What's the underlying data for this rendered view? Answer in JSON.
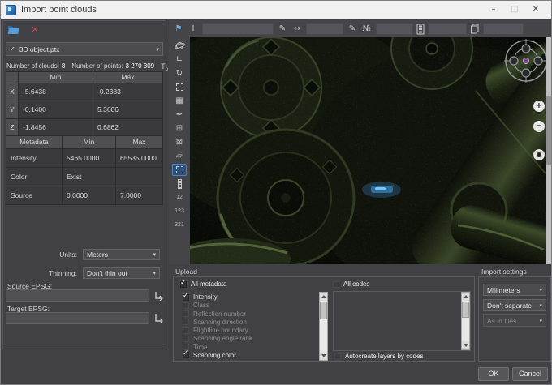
{
  "window": {
    "title": "Import point clouds"
  },
  "titlebar": {
    "minimize_glyph": "–",
    "maximize_glyph": "□",
    "close_glyph": "✕"
  },
  "icons": {
    "chevron_down": "▾",
    "check": "✓",
    "delete": "✕",
    "flag": "⚑",
    "ibeam": "I",
    "pencil": "✎",
    "measure": "↔",
    "numero": "№",
    "axis_corner": "∟",
    "rotate": "↻",
    "grid": "▦",
    "brush": "✒",
    "select_add": "⊞",
    "select_remove": "⊠",
    "polygon": "▱",
    "t_zero": "T",
    "t_zero_sub": "o",
    "plus": "+",
    "minus": "−"
  },
  "left_panel": {
    "file_dropdown": {
      "value": "3D object.ptx"
    },
    "clouds_label": "Number of clouds:",
    "clouds_value": "8",
    "points_label": "Number of points:",
    "points_value": "3 270 309",
    "bounds_table": {
      "headers": [
        "",
        "Min",
        "Max"
      ],
      "rows": [
        {
          "axis": "X",
          "min": "-5.6438",
          "max": "-0.2383"
        },
        {
          "axis": "Y",
          "min": "-0.1400",
          "max": "5.3606"
        },
        {
          "axis": "Z",
          "min": "-1.8456",
          "max": "0.6862"
        }
      ]
    },
    "metadata_table": {
      "headers": [
        "Metadata",
        "Min",
        "Max"
      ],
      "rows": [
        {
          "name": "Intensity",
          "min": "5465.0000",
          "max": "65535.0000"
        },
        {
          "name": "Color",
          "min": "Exist",
          "max": ""
        },
        {
          "name": "Source",
          "min": "0.0000",
          "max": "7.0000"
        }
      ]
    },
    "units_label": "Units:",
    "units_value": "Meters",
    "thinning_label": "Thinning:",
    "thinning_value": "Don't thin out",
    "source_epsg_label": "Source EPSG:",
    "source_epsg_value": "",
    "target_epsg_label": "Target EPSG:",
    "target_epsg_value": ""
  },
  "viewport": {
    "scale_buttons": [
      "12",
      "123",
      "321"
    ]
  },
  "upload": {
    "title": "Upload",
    "all_metadata_label": "All metadata",
    "all_codes_label": "All codes",
    "autocreate_label": "Autocreate layers by codes",
    "metadata_items": [
      {
        "label": "Intensity",
        "checked": true,
        "enabled": true
      },
      {
        "label": "Class",
        "checked": false,
        "enabled": false
      },
      {
        "label": "Reflection number",
        "checked": false,
        "enabled": false
      },
      {
        "label": "Scanning direction",
        "checked": false,
        "enabled": false
      },
      {
        "label": "Flightline boundary",
        "checked": false,
        "enabled": false
      },
      {
        "label": "Scanning angle rank",
        "checked": false,
        "enabled": false
      },
      {
        "label": "Time",
        "checked": false,
        "enabled": false
      },
      {
        "label": "Scanning color",
        "checked": true,
        "enabled": true
      }
    ],
    "codes_items": []
  },
  "import_settings": {
    "title": "Import settings",
    "units_value": "Millimeters",
    "separation_value": "Don't separate",
    "layers_value": "As in files"
  },
  "footer": {
    "ok": "OK",
    "cancel": "Cancel"
  },
  "colors": {
    "accent_blue": "#7ab0e0",
    "delete_red": "#c0504d",
    "selected_tool_bg": "#2d4f76",
    "compass_center": "#7a3f8f",
    "glow_blue": "#4aa0d8"
  }
}
